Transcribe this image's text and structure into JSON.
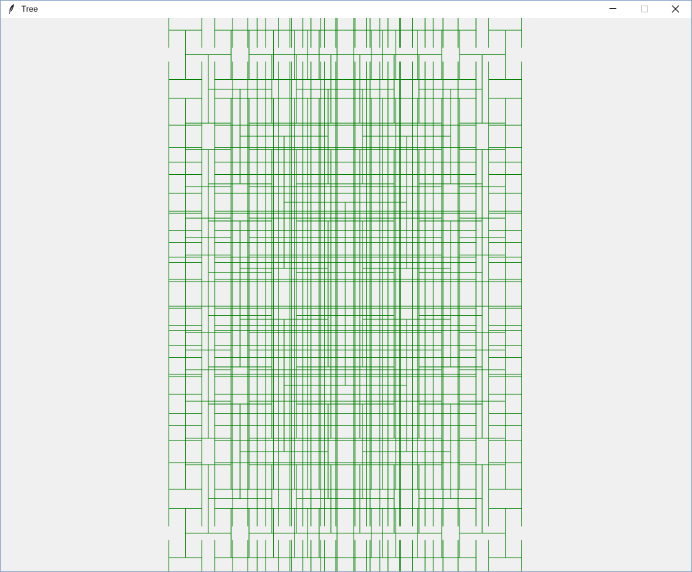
{
  "window": {
    "title": "Tree",
    "icon": "feather-icon",
    "controls": [
      "minimize-icon",
      "maximize-icon",
      "close-icon"
    ]
  },
  "canvas": {
    "drawing": "recursive-tree-fractal",
    "stroke_color": "#008000",
    "background": "#f0f0f0"
  }
}
